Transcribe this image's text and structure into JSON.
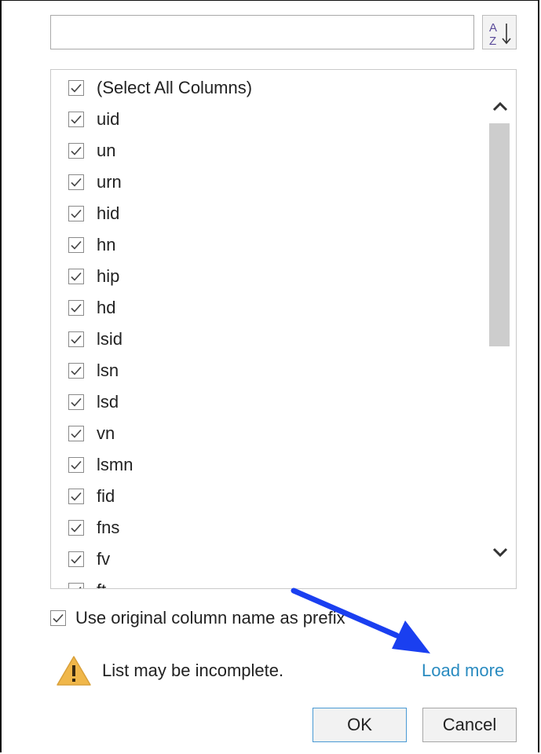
{
  "search": {
    "value": "",
    "placeholder": ""
  },
  "sort_button": {
    "icon": "sort-az-icon",
    "top_letter": "A",
    "bottom_letter": "Z"
  },
  "columns": [
    {
      "label": "(Select All Columns)",
      "checked": true
    },
    {
      "label": "uid",
      "checked": true
    },
    {
      "label": "un",
      "checked": true
    },
    {
      "label": "urn",
      "checked": true
    },
    {
      "label": "hid",
      "checked": true
    },
    {
      "label": "hn",
      "checked": true
    },
    {
      "label": "hip",
      "checked": true
    },
    {
      "label": "hd",
      "checked": true
    },
    {
      "label": "lsid",
      "checked": true
    },
    {
      "label": "lsn",
      "checked": true
    },
    {
      "label": "lsd",
      "checked": true
    },
    {
      "label": "vn",
      "checked": true
    },
    {
      "label": "lsmn",
      "checked": true
    },
    {
      "label": "fid",
      "checked": true
    },
    {
      "label": "fns",
      "checked": true
    },
    {
      "label": "fv",
      "checked": true
    },
    {
      "label": "ft",
      "checked": true
    }
  ],
  "prefix_option": {
    "label": "Use original column name as prefix",
    "checked": true
  },
  "warning": {
    "text": "List may be incomplete.",
    "icon": "warning-icon"
  },
  "load_more": "Load more",
  "buttons": {
    "ok": "OK",
    "cancel": "Cancel"
  },
  "colors": {
    "link": "#2a8bc0",
    "annotation_arrow": "#1a3ff0",
    "warning": "#f0b74a",
    "ok_border": "#4a9ad4"
  }
}
